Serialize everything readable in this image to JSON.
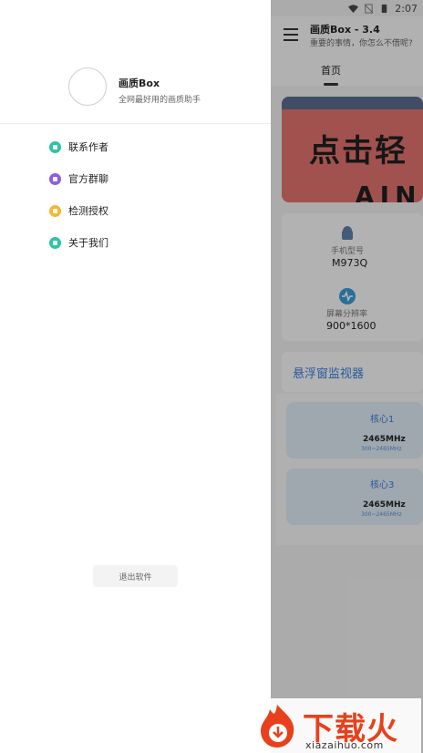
{
  "status_bar": {
    "time": "2:07",
    "battery_icon": "battery-icon",
    "wifi_icon": "wifi-icon",
    "signal_icon": "no-signal-icon"
  },
  "app": {
    "title": "画质Box - 3.4",
    "subtitle": "重要的事情，你怎么不借呢?",
    "tab_home": "首页",
    "banner_text": "点击轻",
    "banner_text2": "AIN",
    "device": {
      "model_label": "手机型号",
      "model_value": "M973Q",
      "resolution_label": "屏幕分辨率",
      "resolution_value": "900*1600"
    },
    "float_title": "悬浮窗监视器",
    "cores": [
      {
        "name": "核心1",
        "freq": "2465MHz",
        "range": "300~2465MHz"
      },
      {
        "name": "核心3",
        "freq": "2465MHz",
        "range": "300~2465MHz"
      }
    ]
  },
  "drawer": {
    "title": "画质Box",
    "subtitle": "全网最好用的画质助手",
    "items": [
      {
        "label": "联系作者",
        "icon": "contact-icon",
        "color": "#2ec4a6"
      },
      {
        "label": "官方群聊",
        "icon": "group-icon",
        "color": "#8e5ce0"
      },
      {
        "label": "检测授权",
        "icon": "license-icon",
        "color": "#f5b82e"
      },
      {
        "label": "关于我们",
        "icon": "about-icon",
        "color": "#2ec4a6"
      }
    ],
    "exit_label": "退出软件"
  },
  "watermark": {
    "text": "下载火",
    "url": "xiazaihuo.com"
  }
}
